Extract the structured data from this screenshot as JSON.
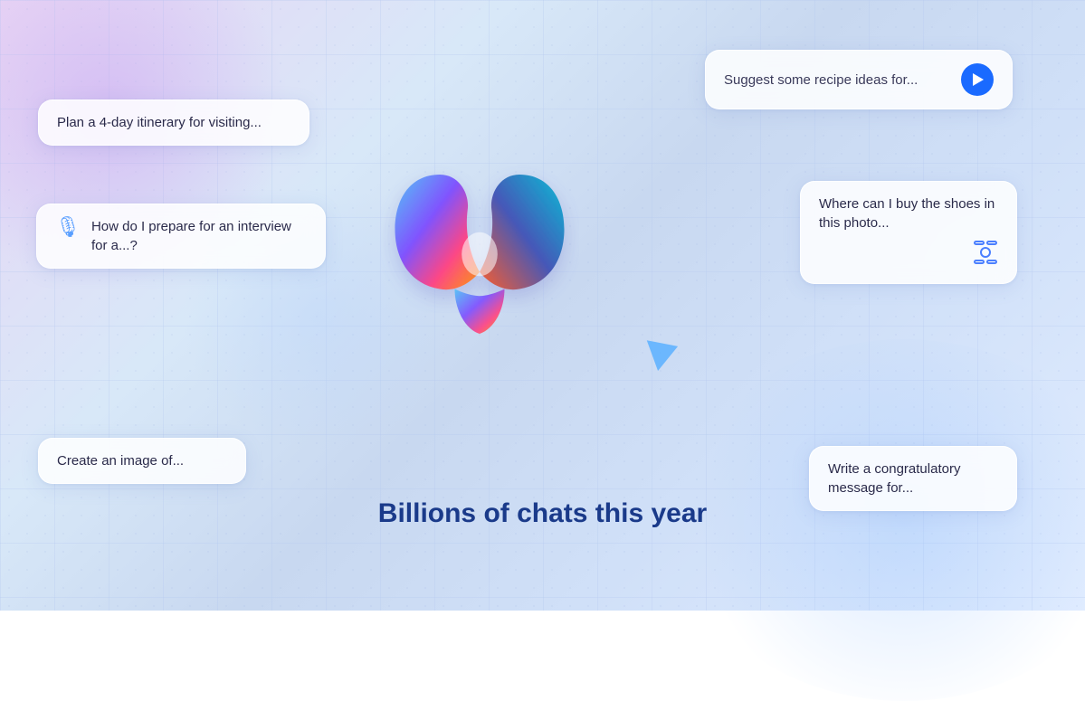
{
  "background": {
    "alt": "Gradient background with grid overlay"
  },
  "heading": {
    "text": "Billions of chats this year"
  },
  "cards": {
    "itinerary": {
      "text": "Plan a 4-day itinerary for visiting..."
    },
    "recipe": {
      "text": "Suggest some recipe ideas for...",
      "send_label": "Send"
    },
    "interview": {
      "text": "How do I prepare for an interview for a...?",
      "mic_icon": "🎤"
    },
    "shoes": {
      "text": "Where can I buy the shoes in this photo...",
      "camera_icon": "⊙"
    },
    "image_create": {
      "text": "Create an image of..."
    },
    "congrats": {
      "text": "Write a congratulatory message for..."
    }
  },
  "cursor": {
    "alt": "cursor arrow"
  },
  "logo": {
    "alt": "Microsoft Copilot logo"
  }
}
